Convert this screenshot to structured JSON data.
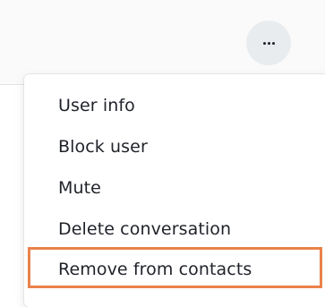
{
  "header": {
    "more_button": {
      "icon": "ellipsis-horizontal-icon"
    }
  },
  "menu": {
    "items": [
      {
        "label": "User info"
      },
      {
        "label": "Block user"
      },
      {
        "label": "Mute"
      },
      {
        "label": "Delete conversation"
      },
      {
        "label": "Remove from contacts"
      }
    ]
  },
  "highlight": {
    "color": "#e9824b"
  }
}
